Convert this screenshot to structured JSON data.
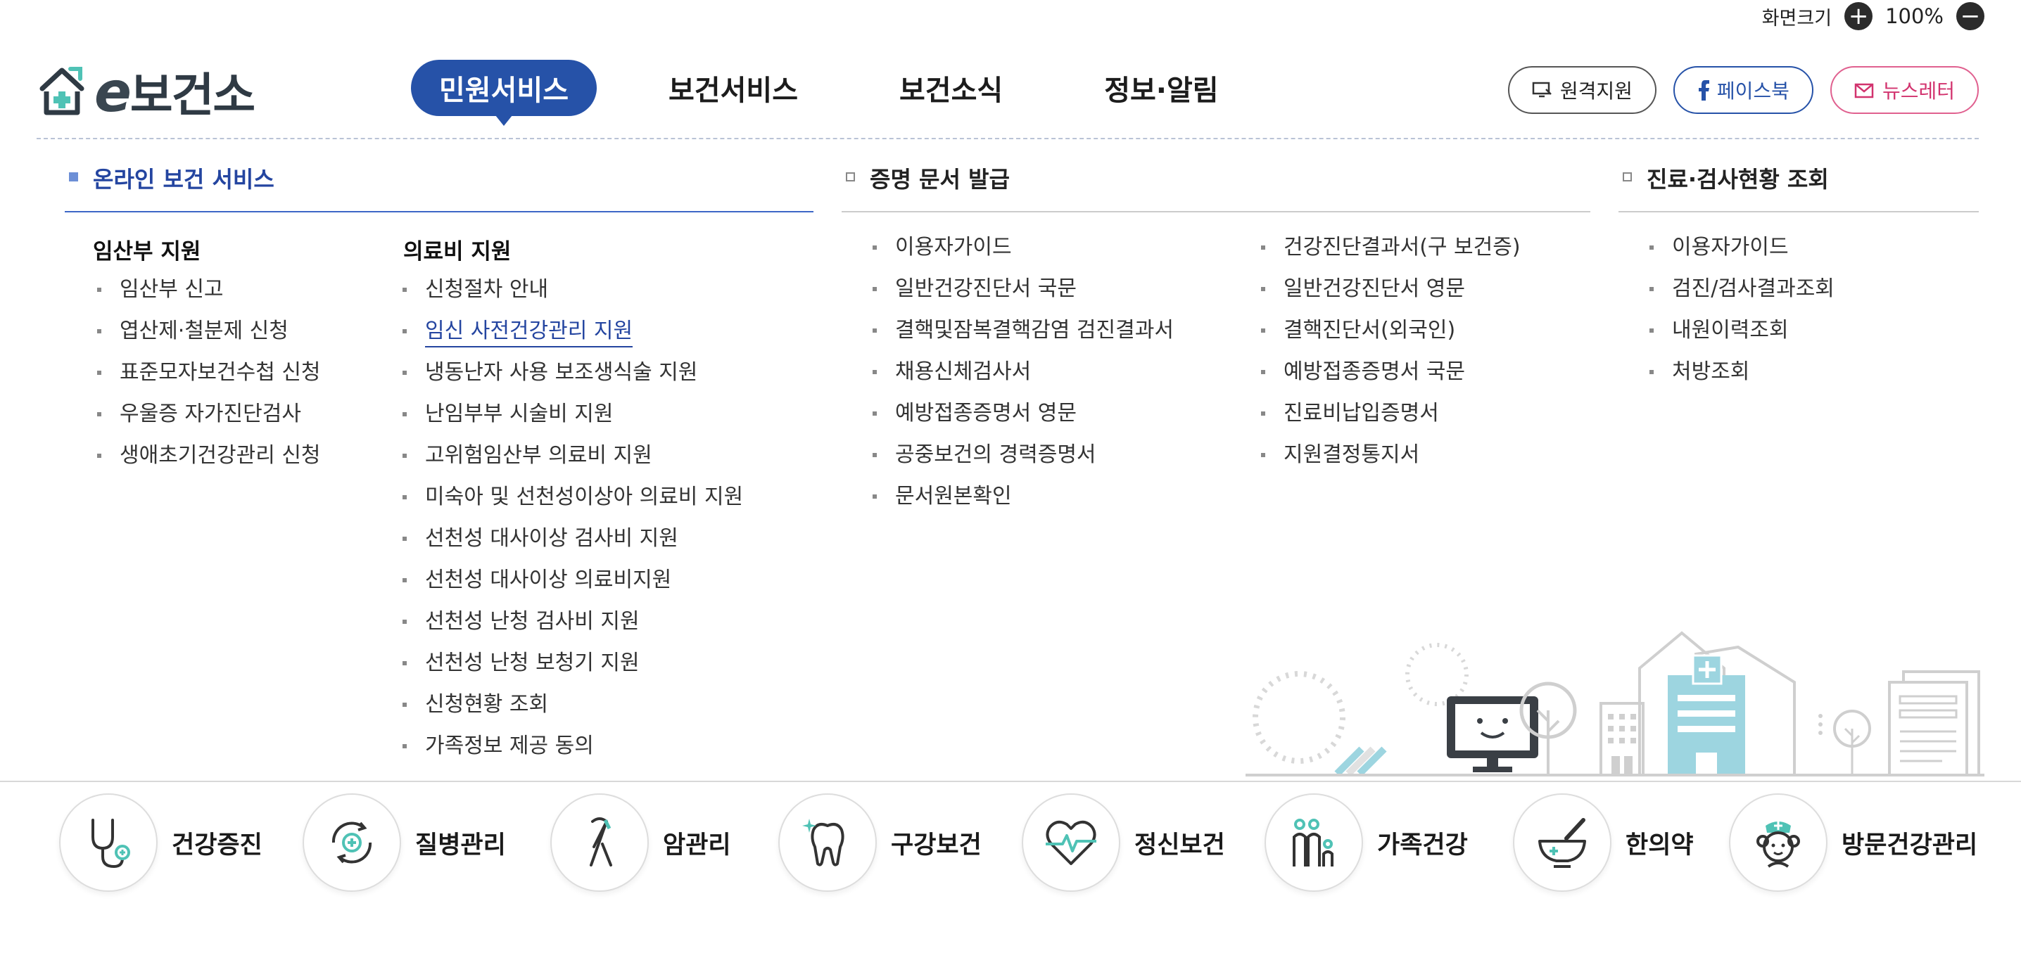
{
  "topbar": {
    "screen_size_label": "화면크기",
    "zoom_in": "+",
    "zoom_value": "100%",
    "zoom_out": "−"
  },
  "logo": {
    "e": "e",
    "text": "보건소"
  },
  "gnb": [
    {
      "label": "민원서비스",
      "active": true
    },
    {
      "label": "보건서비스"
    },
    {
      "label": "보건소식"
    },
    {
      "label": "정보·알림"
    }
  ],
  "header_buttons": {
    "remote": "원격지원",
    "facebook": "페이스북",
    "newsletter": "뉴스레터"
  },
  "menu": {
    "col1": {
      "title": "온라인 보건 서비스",
      "groupA": {
        "heading": "임산부 지원",
        "items": [
          "임산부 신고",
          "엽산제·철분제 신청",
          "표준모자보건수첩 신청",
          "우울증 자가진단검사",
          "생애초기건강관리 신청"
        ]
      },
      "groupB": {
        "heading": "의료비 지원",
        "items": [
          "신청절차 안내",
          "임신 사전건강관리 지원",
          "냉동난자 사용 보조생식술 지원",
          "난임부부 시술비 지원",
          "고위험임산부 의료비 지원",
          "미숙아 및 선천성이상아 의료비 지원",
          "선천성 대사이상 검사비 지원",
          "선천성 대사이상 의료비지원",
          "선천성 난청 검사비 지원",
          "선천성 난청 보청기 지원",
          "신청현황 조회",
          "가족정보 제공 동의"
        ]
      }
    },
    "col2": {
      "title": "증명 문서 발급",
      "itemsA": [
        "이용자가이드",
        "일반건강진단서 국문",
        "결핵및잠복결핵감염 검진결과서",
        "채용신체검사서",
        "예방접종증명서 영문",
        "공중보건의 경력증명서",
        "문서원본확인"
      ],
      "itemsB": [
        "건강진단결과서(구 보건증)",
        "일반건강진단서 영문",
        "결핵진단서(외국인)",
        "예방접종증명서 국문",
        "진료비납입증명서",
        "지원결정통지서"
      ]
    },
    "col3": {
      "title": "진료·검사현황 조회",
      "items": [
        "이용자가이드",
        "검진/검사결과조회",
        "내원이력조회",
        "처방조회"
      ]
    }
  },
  "quick_menu": [
    {
      "label": "건강증진",
      "icon": "stethoscope-icon"
    },
    {
      "label": "질병관리",
      "icon": "disease-management-icon"
    },
    {
      "label": "암관리",
      "icon": "ribbon-icon"
    },
    {
      "label": "구강보건",
      "icon": "tooth-icon"
    },
    {
      "label": "정신보건",
      "icon": "heart-pulse-icon"
    },
    {
      "label": "가족건강",
      "icon": "family-icon"
    },
    {
      "label": "한의약",
      "icon": "mortar-pestle-icon"
    },
    {
      "label": "방문건강관리",
      "icon": "nurse-icon"
    }
  ],
  "colors": {
    "primary": "#2652a8",
    "teal": "#4fc2b5",
    "pink": "#d2336e",
    "illust_blue": "#9dd5e0"
  }
}
